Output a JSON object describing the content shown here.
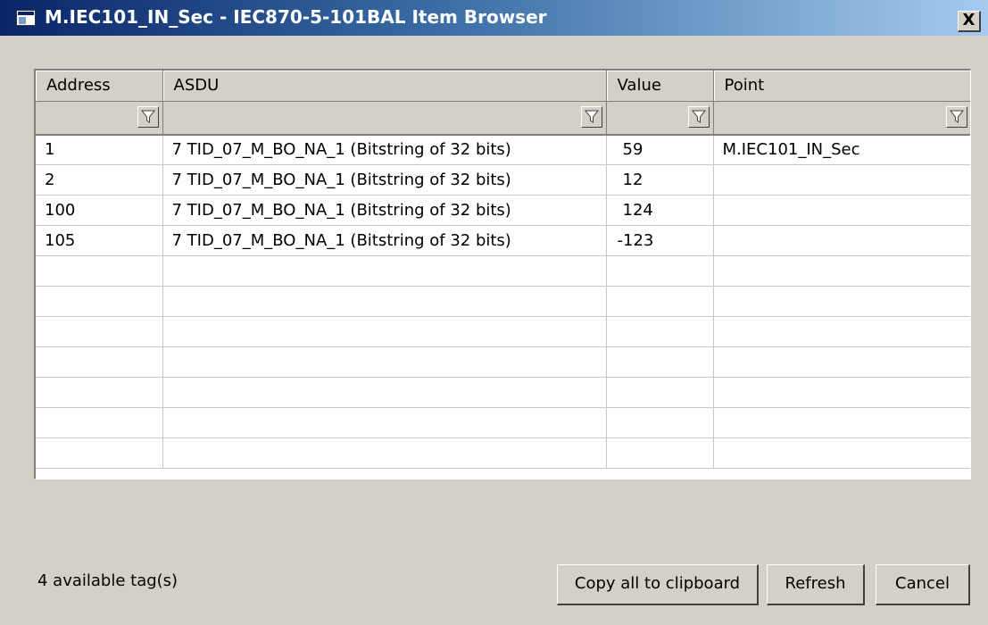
{
  "window": {
    "title": "M.IEC101_IN_Sec - IEC870-5-101BAL Item Browser",
    "close_label": "X"
  },
  "table": {
    "columns": [
      "Address",
      "ASDU",
      "Value",
      "Point"
    ],
    "rows": [
      [
        "1",
        "7 TID_07_M_BO_NA_1 (Bitstring of 32 bits)",
        "59",
        "M.IEC101_IN_Sec"
      ],
      [
        "2",
        "7 TID_07_M_BO_NA_1 (Bitstring of 32 bits)",
        "12",
        ""
      ],
      [
        "100",
        "7 TID_07_M_BO_NA_1 (Bitstring of 32 bits)",
        "124",
        ""
      ],
      [
        "105",
        "7 TID_07_M_BO_NA_1 (Bitstring of 32 bits)",
        "-123",
        ""
      ]
    ],
    "empty_rows": 7,
    "filter_icon": "filter-funnel-icon"
  },
  "status": {
    "text": "4 available tag(s)"
  },
  "buttons": {
    "copy": "Copy all to clipboard",
    "refresh": "Refresh",
    "cancel": "Cancel"
  },
  "colors": {
    "titlebar_start": "#0a246a",
    "titlebar_end": "#a6caf0",
    "face": "#d4d0c8"
  }
}
